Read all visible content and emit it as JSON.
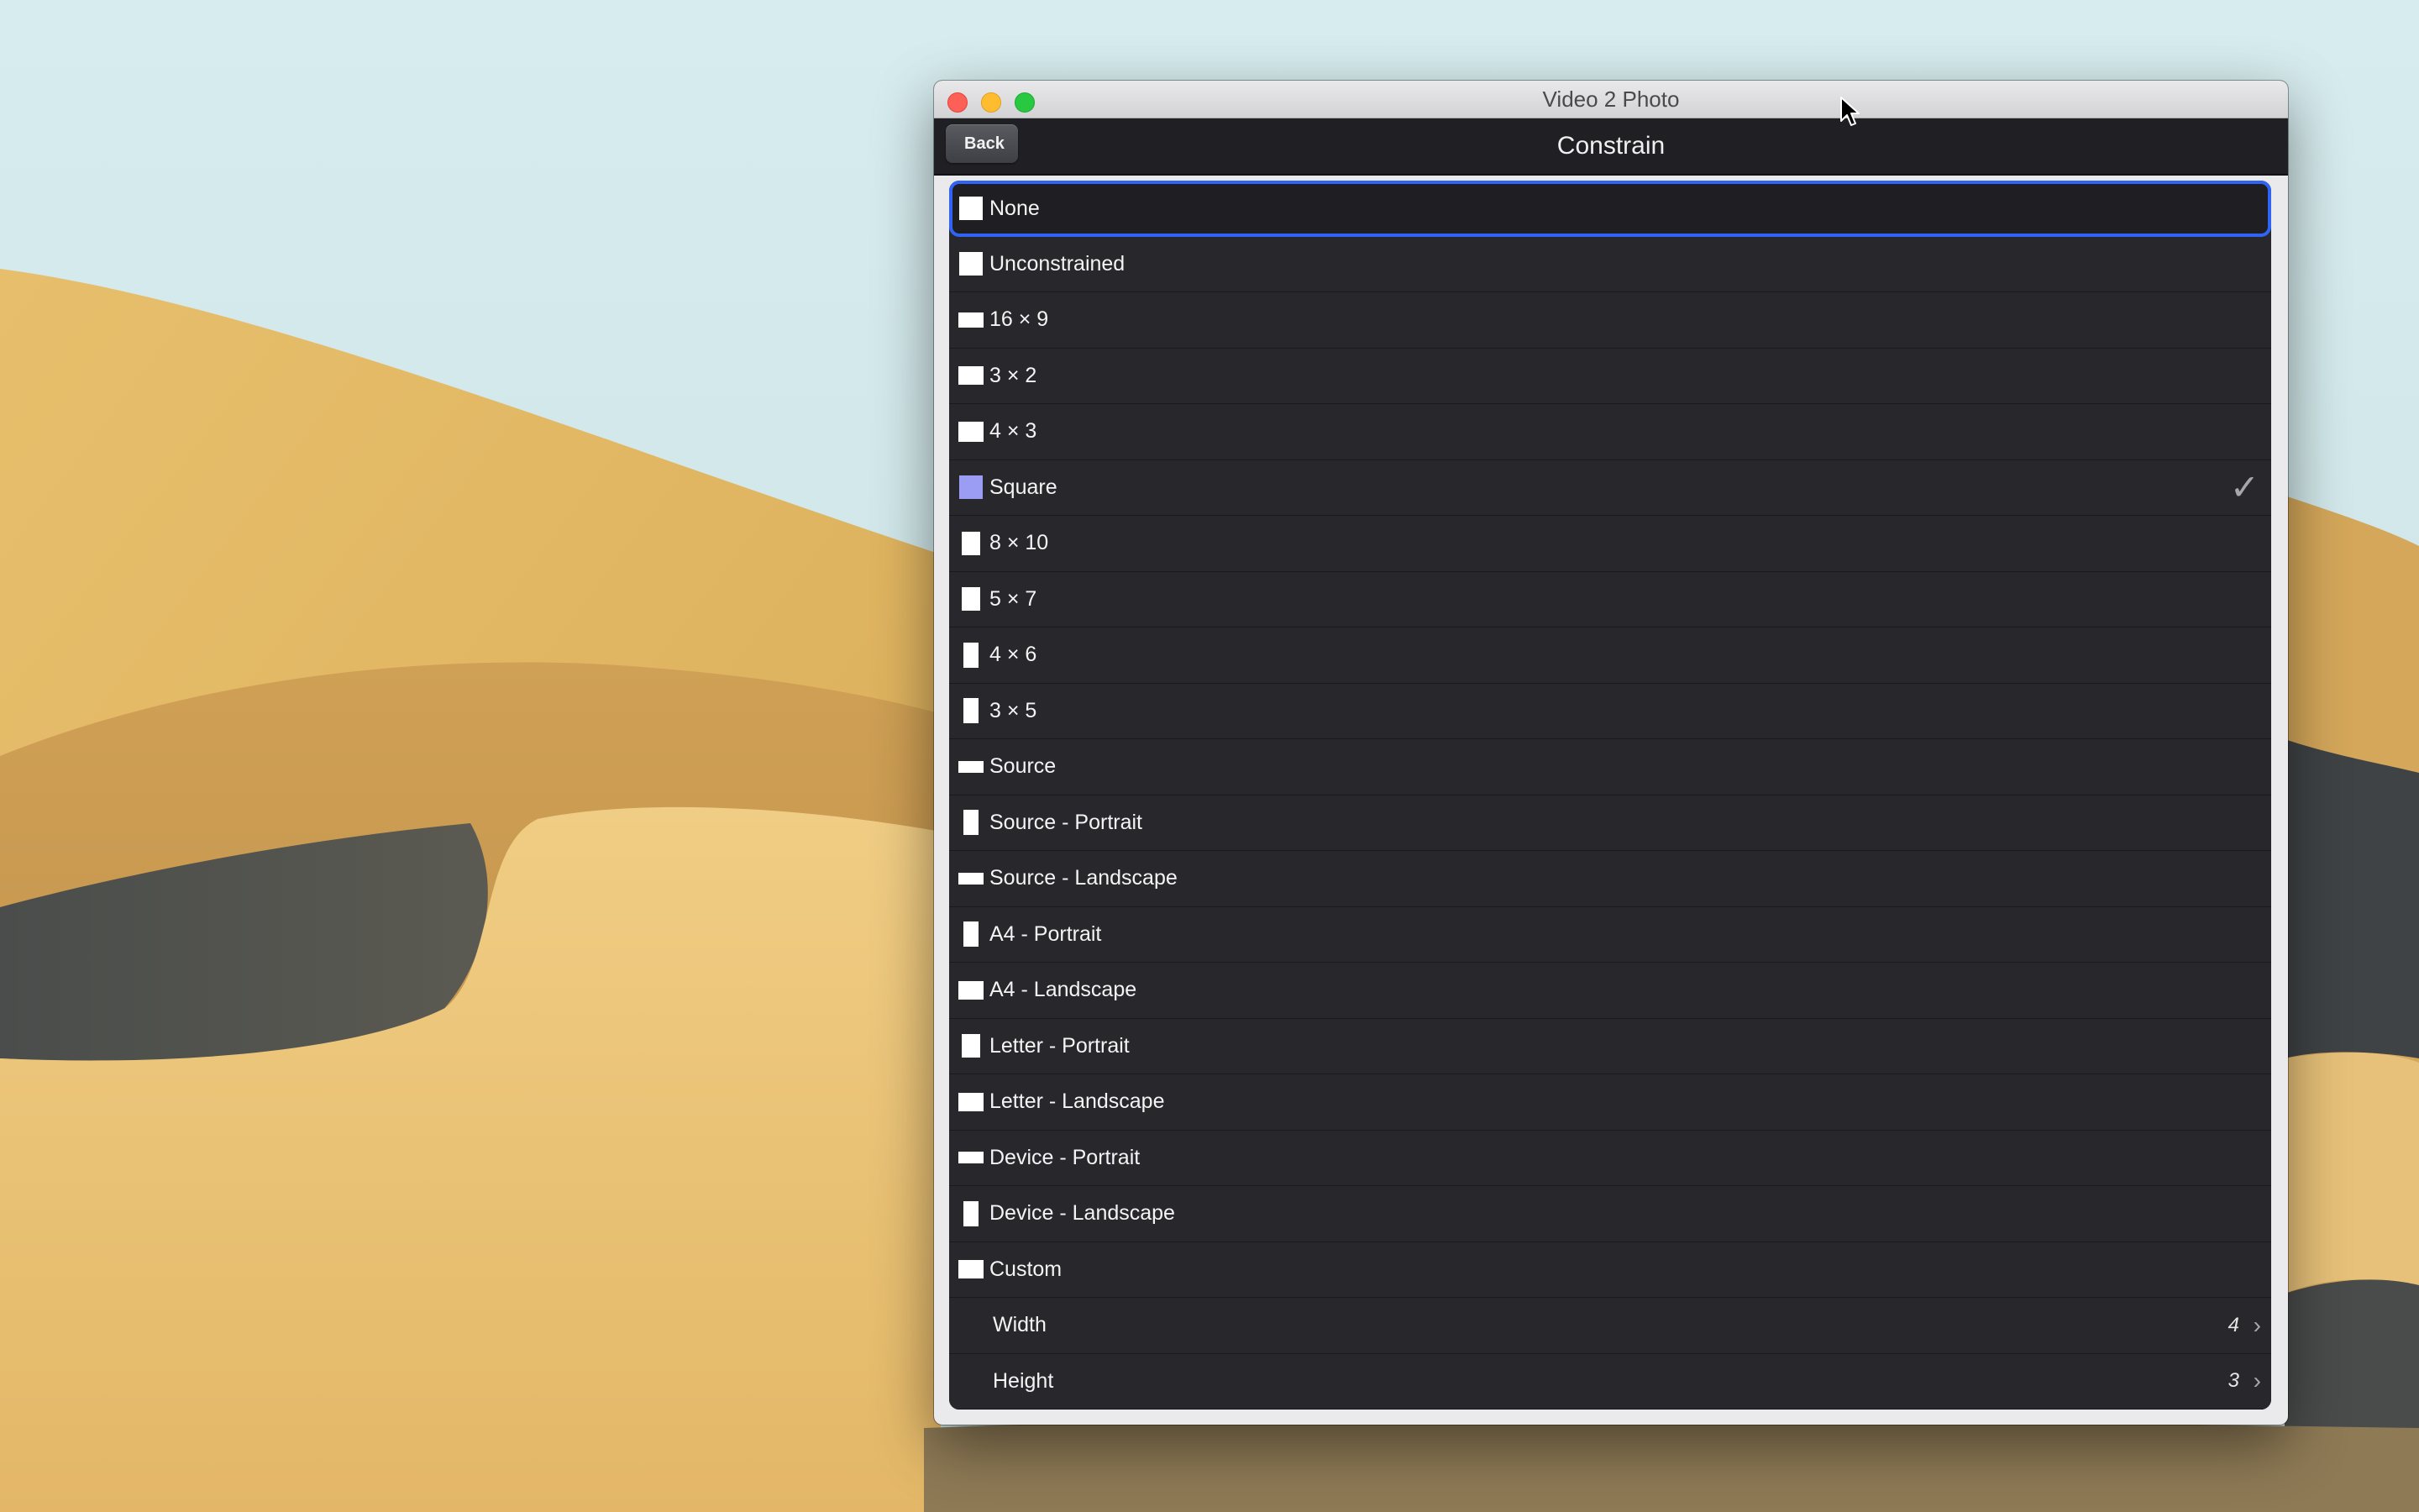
{
  "window": {
    "title": "Video 2 Photo"
  },
  "nav": {
    "back_label": "Back",
    "title": "Constrain"
  },
  "items": [
    {
      "label": "None",
      "icon": "square-icon",
      "shape": "sq"
    },
    {
      "label": "Unconstrained",
      "icon": "square-icon",
      "shape": "sq"
    },
    {
      "label": "16 × 9",
      "icon": "wide-rectangle-icon",
      "shape": "wide"
    },
    {
      "label": "3 × 2",
      "icon": "landscape-rectangle-icon",
      "shape": "land"
    },
    {
      "label": "4 × 3",
      "icon": "landscape-rectangle-icon",
      "shape": "land2"
    },
    {
      "label": "Square",
      "icon": "square-icon",
      "shape": "selected",
      "checked": true
    },
    {
      "label": "8 × 10",
      "icon": "portrait-rectangle-icon",
      "shape": "tall"
    },
    {
      "label": "5 × 7",
      "icon": "portrait-rectangle-icon",
      "shape": "tall"
    },
    {
      "label": "4 × 6",
      "icon": "portrait-rectangle-icon",
      "shape": "thin"
    },
    {
      "label": "3 × 5",
      "icon": "portrait-rectangle-icon",
      "shape": "thin"
    },
    {
      "label": "Source",
      "icon": "wide-rectangle-icon",
      "shape": "widest"
    },
    {
      "label": "Source - Portrait",
      "icon": "portrait-rectangle-icon",
      "shape": "thin"
    },
    {
      "label": "Source - Landscape",
      "icon": "wide-rectangle-icon",
      "shape": "widest"
    },
    {
      "label": "A4 - Portrait",
      "icon": "portrait-rectangle-icon",
      "shape": "thin"
    },
    {
      "label": "A4 - Landscape",
      "icon": "landscape-rectangle-icon",
      "shape": "land"
    },
    {
      "label": "Letter - Portrait",
      "icon": "portrait-rectangle-icon",
      "shape": "tall"
    },
    {
      "label": "Letter - Landscape",
      "icon": "landscape-rectangle-icon",
      "shape": "land"
    },
    {
      "label": "Device - Portrait",
      "icon": "wide-rectangle-icon",
      "shape": "widest"
    },
    {
      "label": "Device - Landscape",
      "icon": "portrait-rectangle-icon",
      "shape": "thin"
    },
    {
      "label": "Custom",
      "icon": "landscape-rectangle-icon",
      "shape": "land"
    }
  ],
  "custom": {
    "width_label": "Width",
    "width_value": "4",
    "height_label": "Height",
    "height_value": "3"
  },
  "check_glyph": "✓",
  "chevron_glyph": "›",
  "colors": {
    "focus_ring": "#2f64f5",
    "selected_icon": "#9b9cf4",
    "row_background": "#27272c"
  }
}
